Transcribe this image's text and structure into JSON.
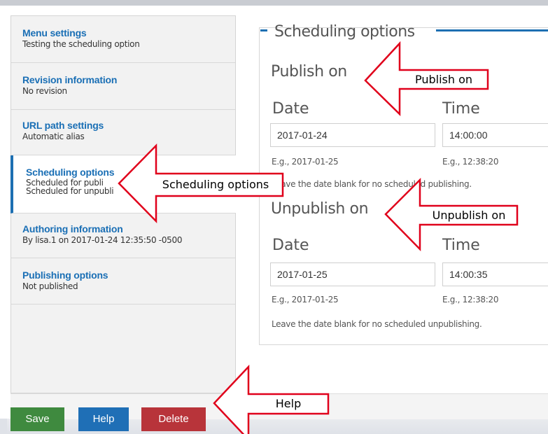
{
  "sidebar": {
    "items": [
      {
        "title": "Menu settings",
        "sub": [
          "Testing the scheduling option"
        ]
      },
      {
        "title": "Revision information",
        "sub": [
          "No revision"
        ]
      },
      {
        "title": "URL path settings",
        "sub": [
          "Automatic alias"
        ]
      },
      {
        "title": "Scheduling options",
        "sub": [
          "Scheduled for publi",
          "Scheduled for unpubli"
        ]
      },
      {
        "title": "Authoring information",
        "sub": [
          "By lisa.1 on 2017-01-24 12:35:50 -0500"
        ]
      },
      {
        "title": "Publishing options",
        "sub": [
          "Not published"
        ]
      }
    ]
  },
  "main": {
    "legend": "Scheduling options",
    "publish": {
      "title": "Publish on",
      "date_label": "Date",
      "time_label": "Time",
      "date_value": "2017-01-24",
      "time_value": "14:00:00",
      "date_hint": "E.g., 2017-01-25",
      "time_hint": "E.g., 12:38:20",
      "help": "Leave the date blank for no scheduled publishing."
    },
    "unpublish": {
      "title": "Unpublish on",
      "date_label": "Date",
      "time_label": "Time",
      "date_value": "2017-01-25",
      "time_value": "14:00:35",
      "date_hint": "E.g., 2017-01-25",
      "time_hint": "E.g., 12:38:20",
      "help": "Leave the date blank for no scheduled unpublishing."
    }
  },
  "buttons": {
    "save": "Save",
    "help": "Help",
    "delete": "Delete"
  },
  "callouts": {
    "publish_on": "Publish on",
    "scheduling_options": "Scheduling options",
    "unpublish_on": "Unpublish on",
    "help": "Help"
  },
  "colors": {
    "accent": "#1d6fb2",
    "save": "#3f8a3f",
    "help": "#1f6fb6",
    "delete": "#b8343a",
    "arrow": "#e0001b"
  }
}
